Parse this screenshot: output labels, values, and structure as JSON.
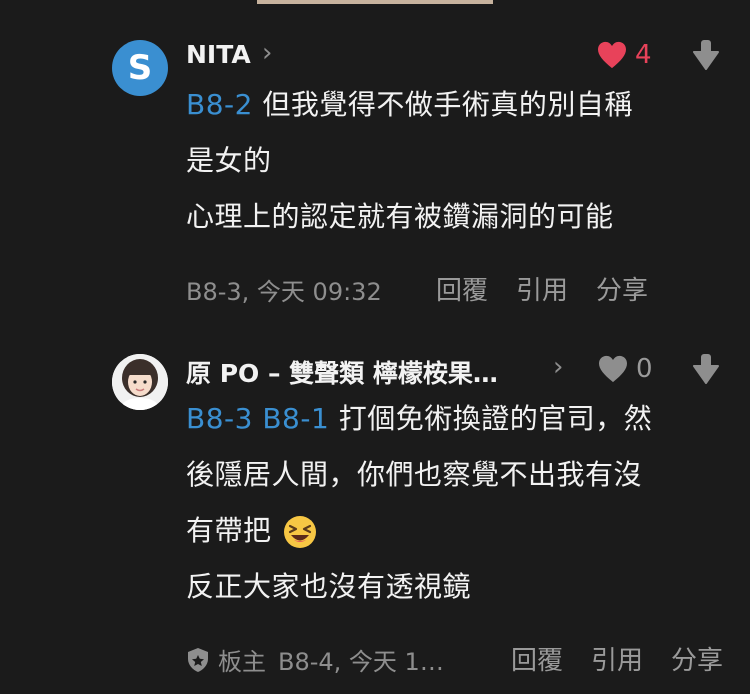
{
  "comments": [
    {
      "author": "NITA",
      "avatar_letter": "S",
      "avatar_color": "#3a8fd1",
      "like_count": "4",
      "liked": true,
      "like_color": "#e8425a",
      "reply_ref": "B8-2",
      "body_lines": [
        "但我覺得不做手術真的別自稱",
        "是女的",
        "心理上的認定就有被鑽漏洞的可能"
      ],
      "meta": "B8-3, 今天 09:32",
      "actions": {
        "reply": "回覆",
        "quote": "引用",
        "share": "分享"
      }
    },
    {
      "author": "原 PO – 雙聲類 檸檬桉果…",
      "avatar_letter": "",
      "like_count": "0",
      "liked": false,
      "reply_refs": "B8-3 B8-1",
      "body_first": "打個免術換證的官司，然",
      "body_lines": [
        "後隱居人間，你們也察覺不出我有沒",
        "有帶把",
        "反正大家也沒有透視鏡"
      ],
      "badge": "板主",
      "meta": "B8-4, 今天 1…",
      "actions": {
        "reply": "回覆",
        "quote": "引用",
        "share": "分享"
      }
    }
  ],
  "icons": {
    "chevron": "chevron-right-icon",
    "heart": "heart-icon",
    "downvote": "down-arrow-icon",
    "badge": "moderator-shield-icon",
    "emoji": "laughing-emoji-icon"
  },
  "glyphs": {
    "chevron": "›"
  }
}
